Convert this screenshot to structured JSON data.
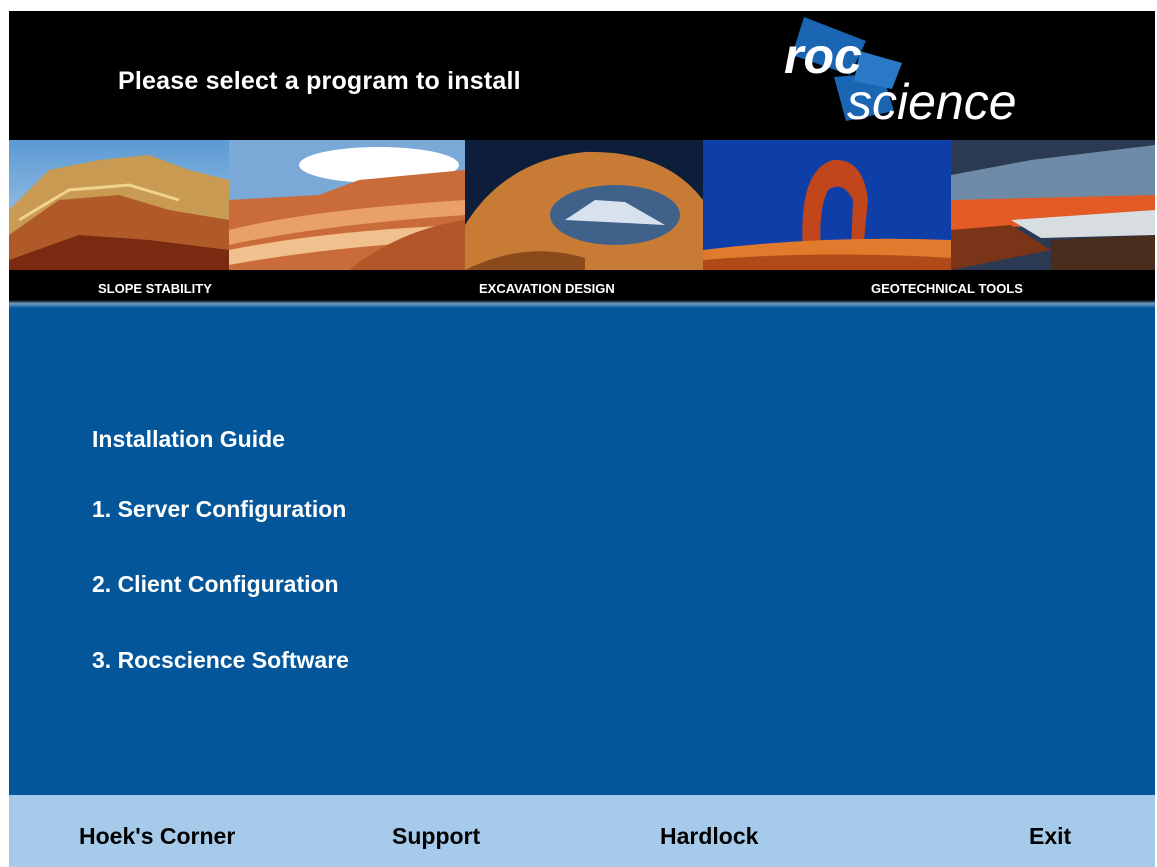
{
  "header": {
    "title": "Please select a program to install"
  },
  "logo": {
    "text_top": "roc",
    "text_bottom": "science",
    "accent_color": "#1b66b3"
  },
  "categories": [
    {
      "label": "SLOPE STABILITY"
    },
    {
      "label": "EXCAVATION DESIGN"
    },
    {
      "label": "GEOTECHNICAL TOOLS"
    }
  ],
  "menu": {
    "items": [
      {
        "label": "Installation Guide"
      },
      {
        "label": "1. Server Configuration"
      },
      {
        "label": "2. Client Configuration"
      },
      {
        "label": "3. Rocscience Software"
      }
    ]
  },
  "footer": {
    "buttons": [
      {
        "label": "Hoek's Corner"
      },
      {
        "label": "Support"
      },
      {
        "label": "Hardlock"
      },
      {
        "label": "Exit"
      }
    ]
  },
  "colors": {
    "background": "#03569a",
    "footer": "#a6cbea",
    "header": "#000000"
  }
}
